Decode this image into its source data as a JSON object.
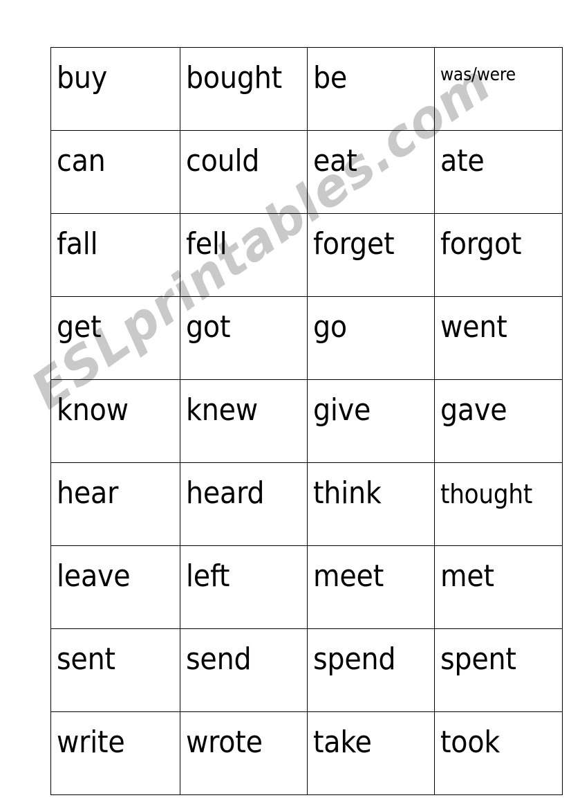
{
  "page": {
    "background_color": "#ffffff",
    "text_color": "#000000",
    "border_color": "#000000"
  },
  "watermark": {
    "text": "ESLprintables.com",
    "color": "#c9c9c9",
    "rotation_degrees": -35.5
  },
  "table": {
    "columns": 4,
    "row_count": 9,
    "rows": [
      [
        {
          "text": "buy",
          "size": "normal"
        },
        {
          "text": "bought",
          "size": "normal"
        },
        {
          "text": "be",
          "size": "normal"
        },
        {
          "text": "was/were",
          "size": "small"
        }
      ],
      [
        {
          "text": "can",
          "size": "normal"
        },
        {
          "text": "could",
          "size": "normal"
        },
        {
          "text": "eat",
          "size": "normal"
        },
        {
          "text": "ate",
          "size": "normal"
        }
      ],
      [
        {
          "text": "fall",
          "size": "normal"
        },
        {
          "text": "fell",
          "size": "normal"
        },
        {
          "text": "forget",
          "size": "normal"
        },
        {
          "text": "forgot",
          "size": "normal"
        }
      ],
      [
        {
          "text": "get",
          "size": "normal"
        },
        {
          "text": "got",
          "size": "normal"
        },
        {
          "text": "go",
          "size": "normal"
        },
        {
          "text": "went",
          "size": "normal"
        }
      ],
      [
        {
          "text": "know",
          "size": "normal"
        },
        {
          "text": "knew",
          "size": "normal"
        },
        {
          "text": "give",
          "size": "normal"
        },
        {
          "text": "gave",
          "size": "normal"
        }
      ],
      [
        {
          "text": "hear",
          "size": "normal"
        },
        {
          "text": "heard",
          "size": "normal"
        },
        {
          "text": "think",
          "size": "normal"
        },
        {
          "text": "thought",
          "size": "medium"
        }
      ],
      [
        {
          "text": "leave",
          "size": "normal"
        },
        {
          "text": "left",
          "size": "normal"
        },
        {
          "text": "meet",
          "size": "normal"
        },
        {
          "text": "met",
          "size": "normal"
        }
      ],
      [
        {
          "text": "sent",
          "size": "normal"
        },
        {
          "text": "send",
          "size": "normal"
        },
        {
          "text": "spend",
          "size": "normal"
        },
        {
          "text": "spent",
          "size": "normal"
        }
      ],
      [
        {
          "text": "write",
          "size": "normal"
        },
        {
          "text": "wrote",
          "size": "normal"
        },
        {
          "text": "take",
          "size": "normal"
        },
        {
          "text": "took",
          "size": "normal"
        }
      ]
    ]
  }
}
